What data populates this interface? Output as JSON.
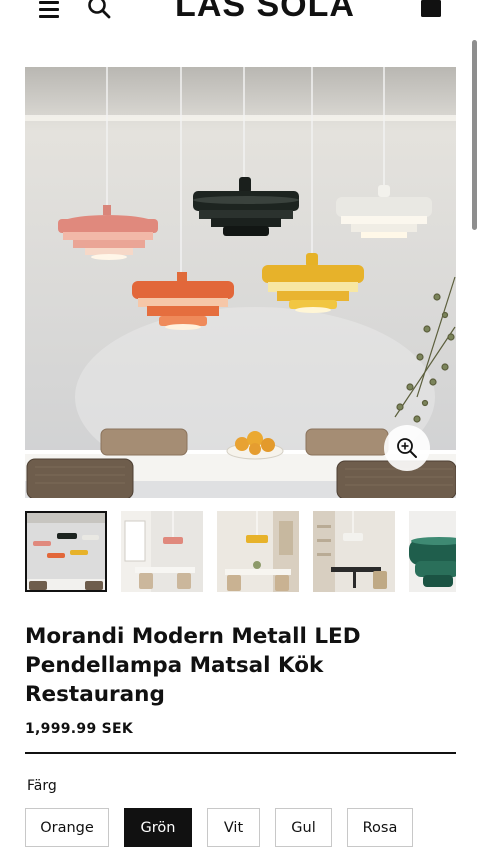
{
  "header": {
    "brand": "LAS SOLA",
    "menu_icon": "hamburger-menu-icon",
    "search_icon": "search-icon",
    "cart_icon": "shopping-bag-icon"
  },
  "gallery": {
    "zoom_icon": "zoom-in-icon",
    "thumbnail_count_visible": 5,
    "active_thumbnail": 1
  },
  "product": {
    "title": "Morandi Modern Metall LED Pendellampa Matsal Kök Restaurang",
    "price": "1,999.99 SEK"
  },
  "color_selector": {
    "label": "Färg",
    "options": [
      "Orange",
      "Grön",
      "Vit",
      "Gul",
      "Rosa"
    ],
    "selected": "Grön"
  },
  "colors": {
    "text": "#111111",
    "selected_bg": "#111111",
    "option_border": "#c8c8c8"
  }
}
